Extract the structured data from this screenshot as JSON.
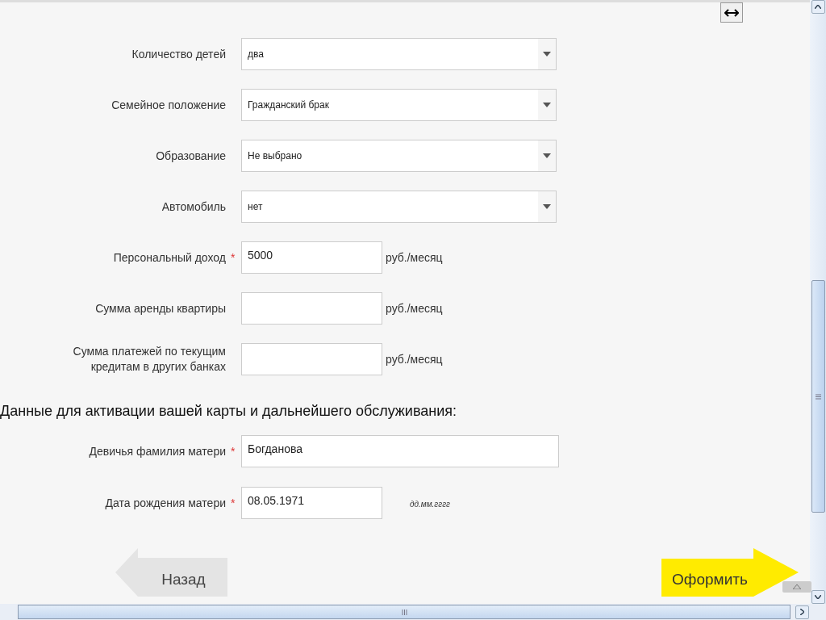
{
  "fields": [
    {
      "kind": "select",
      "label": "Количество детей",
      "value": "два"
    },
    {
      "kind": "select",
      "label": "Семейное положение",
      "value": "Гражданский брак"
    },
    {
      "kind": "select",
      "label": "Образование",
      "value": "Не выбрано"
    },
    {
      "kind": "select",
      "label": "Автомобиль",
      "value": "нет"
    },
    {
      "kind": "text",
      "label": "Персональный доход",
      "marker": "*",
      "value": "5000",
      "unit": "руб./месяц"
    },
    {
      "kind": "text",
      "label": "Сумма аренды квартиры",
      "unit": "руб./месяц"
    },
    {
      "kind": "text",
      "label": "Сумма платежей по текущим кредитам в других банках",
      "unit": "руб./месяц"
    }
  ],
  "section_title": "Данные для активации вашей карты и дальнейшего обслуживания:",
  "card_fields": [
    {
      "kind": "wide",
      "label": "Девичья фамилия матери",
      "marker": "*",
      "value": "Богданова"
    },
    {
      "kind": "text",
      "label": "Дата рождения матери",
      "marker": "*",
      "value": "08.05.1971",
      "hint": "дд.мм.гггг"
    }
  ],
  "back_button": "Назад",
  "submit_button": "Оформить"
}
